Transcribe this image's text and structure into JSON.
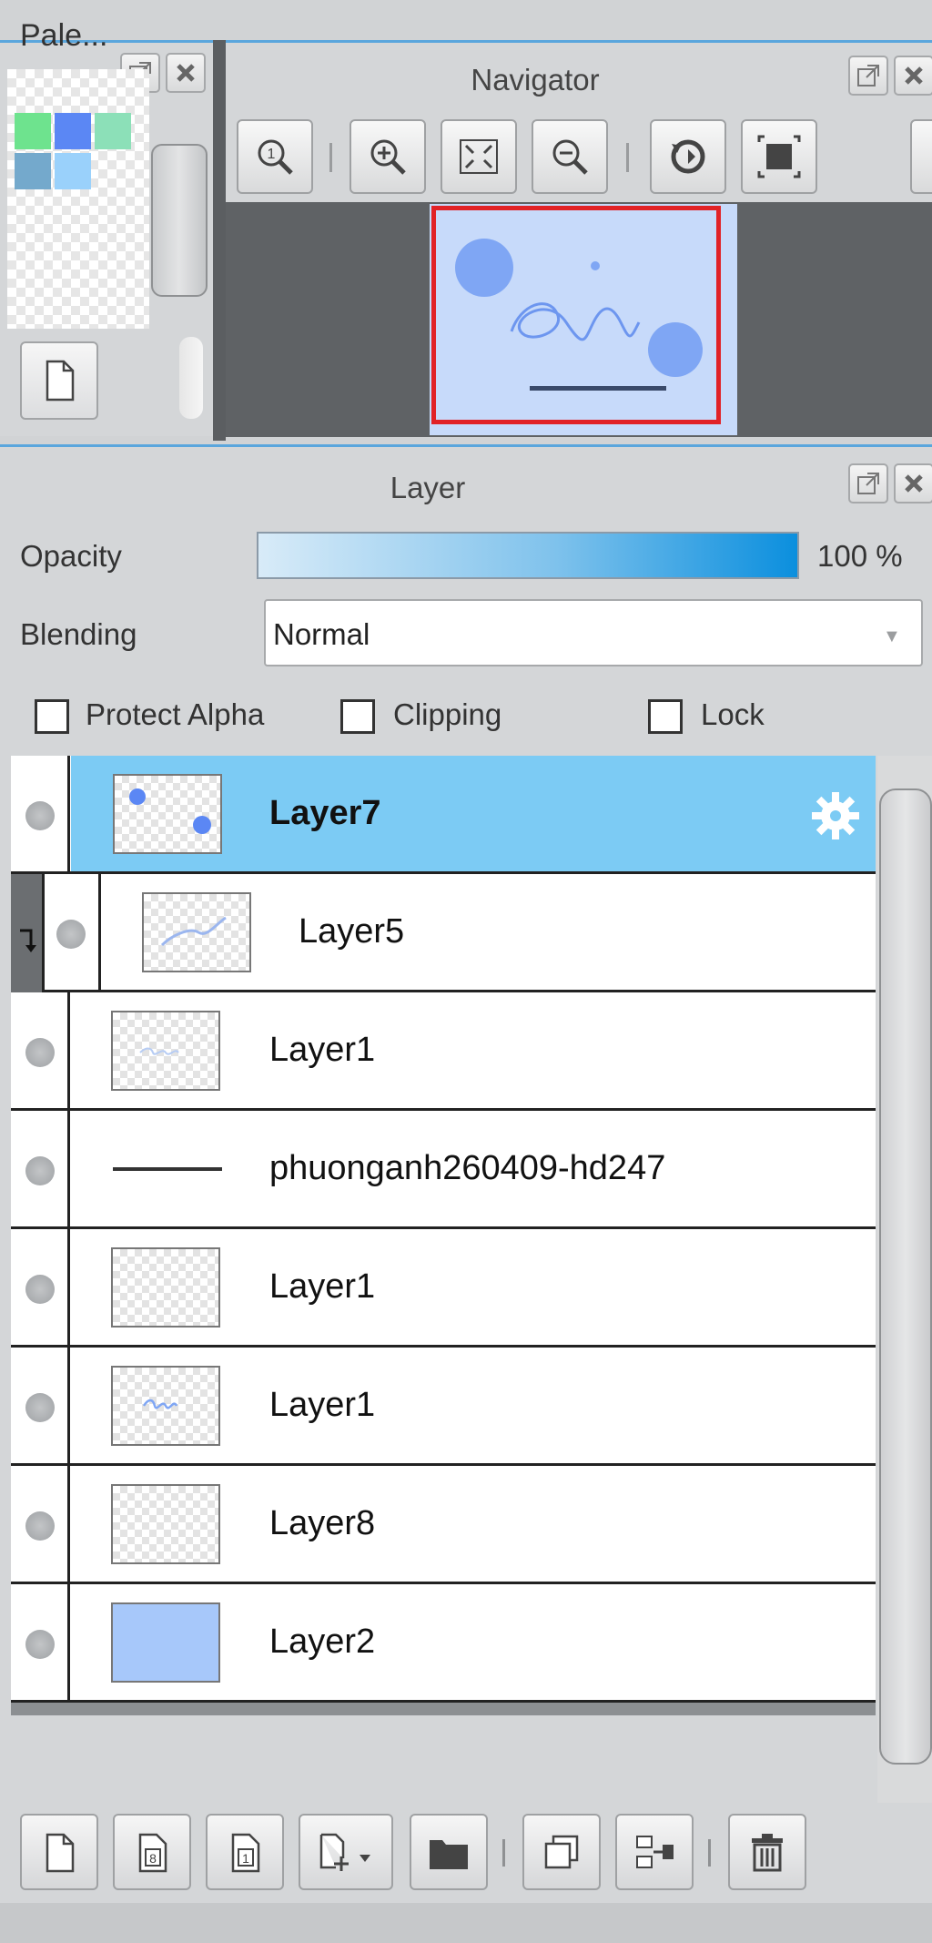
{
  "palette": {
    "title": "Pale...",
    "swatches": [
      "#6ee38e",
      "#5b87f4",
      "#8ce0b8",
      "#74a9cc",
      "#9ad1fb"
    ]
  },
  "navigator": {
    "title": "Navigator",
    "tools": [
      "zoom-reset-icon",
      "zoom-in-icon",
      "fit-screen-icon",
      "zoom-out-icon",
      "rotate-reset-icon",
      "fullscreen-icon"
    ]
  },
  "layer_panel": {
    "title": "Layer",
    "opacity_label": "Opacity",
    "opacity_value": "100 %",
    "opacity_fraction": 1.0,
    "blending_label": "Blending",
    "blending_value": "Normal",
    "protect_alpha_label": "Protect Alpha",
    "clipping_label": "Clipping",
    "lock_label": "Lock",
    "layers": [
      {
        "name": "Layer7",
        "selected": true
      },
      {
        "name": "Layer5",
        "clipped": true
      },
      {
        "name": "Layer1"
      },
      {
        "name": "phuonganh260409-hd247",
        "text_layer": true
      },
      {
        "name": "Layer1"
      },
      {
        "name": "Layer1"
      },
      {
        "name": "Layer8"
      },
      {
        "name": "Layer2"
      }
    ]
  },
  "colors": {
    "accent": "#5aa6dd",
    "selected_row": "#7ccbf4",
    "viewport_frame": "#e12227"
  }
}
